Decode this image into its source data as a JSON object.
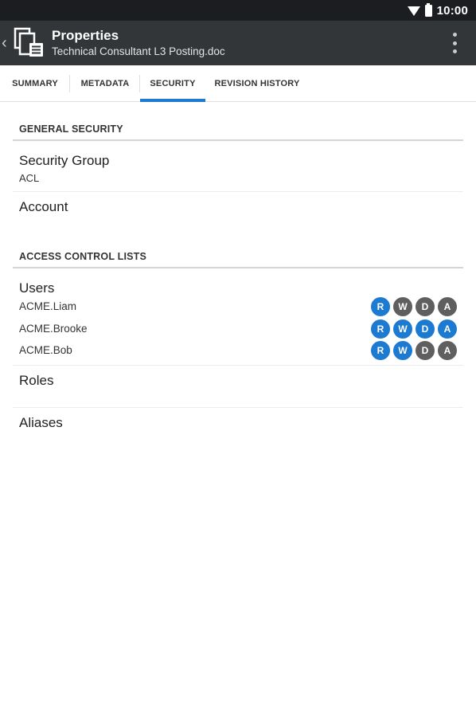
{
  "status_bar": {
    "time": "10:00"
  },
  "app_bar": {
    "title": "Properties",
    "subtitle": "Technical Consultant L3 Posting.doc"
  },
  "tabs": [
    {
      "label": "SUMMARY",
      "active": false
    },
    {
      "label": "METADATA",
      "active": false
    },
    {
      "label": "SECURITY",
      "active": true
    },
    {
      "label": "REVISION HISTORY",
      "active": false
    }
  ],
  "general_security": {
    "heading": "GENERAL SECURITY",
    "security_group_label": "Security Group",
    "security_group_value": "ACL",
    "account_label": "Account"
  },
  "access_control": {
    "heading": "ACCESS CONTROL LISTS",
    "users_label": "Users",
    "users": [
      {
        "name": "ACME.Liam",
        "perms": [
          {
            "letter": "R",
            "granted": true
          },
          {
            "letter": "W",
            "granted": false
          },
          {
            "letter": "D",
            "granted": false
          },
          {
            "letter": "A",
            "granted": false
          }
        ]
      },
      {
        "name": "ACME.Brooke",
        "perms": [
          {
            "letter": "R",
            "granted": true
          },
          {
            "letter": "W",
            "granted": true
          },
          {
            "letter": "D",
            "granted": true
          },
          {
            "letter": "A",
            "granted": true
          }
        ]
      },
      {
        "name": "ACME.Bob",
        "perms": [
          {
            "letter": "R",
            "granted": true
          },
          {
            "letter": "W",
            "granted": true
          },
          {
            "letter": "D",
            "granted": false
          },
          {
            "letter": "A",
            "granted": false
          }
        ]
      }
    ],
    "roles_label": "Roles",
    "aliases_label": "Aliases"
  },
  "colors": {
    "accent": "#1c7bd0",
    "granted": "#1c7bd0",
    "denied": "#5f5f5f",
    "app_bar": "#323639",
    "status_bar": "#1b1d20"
  }
}
